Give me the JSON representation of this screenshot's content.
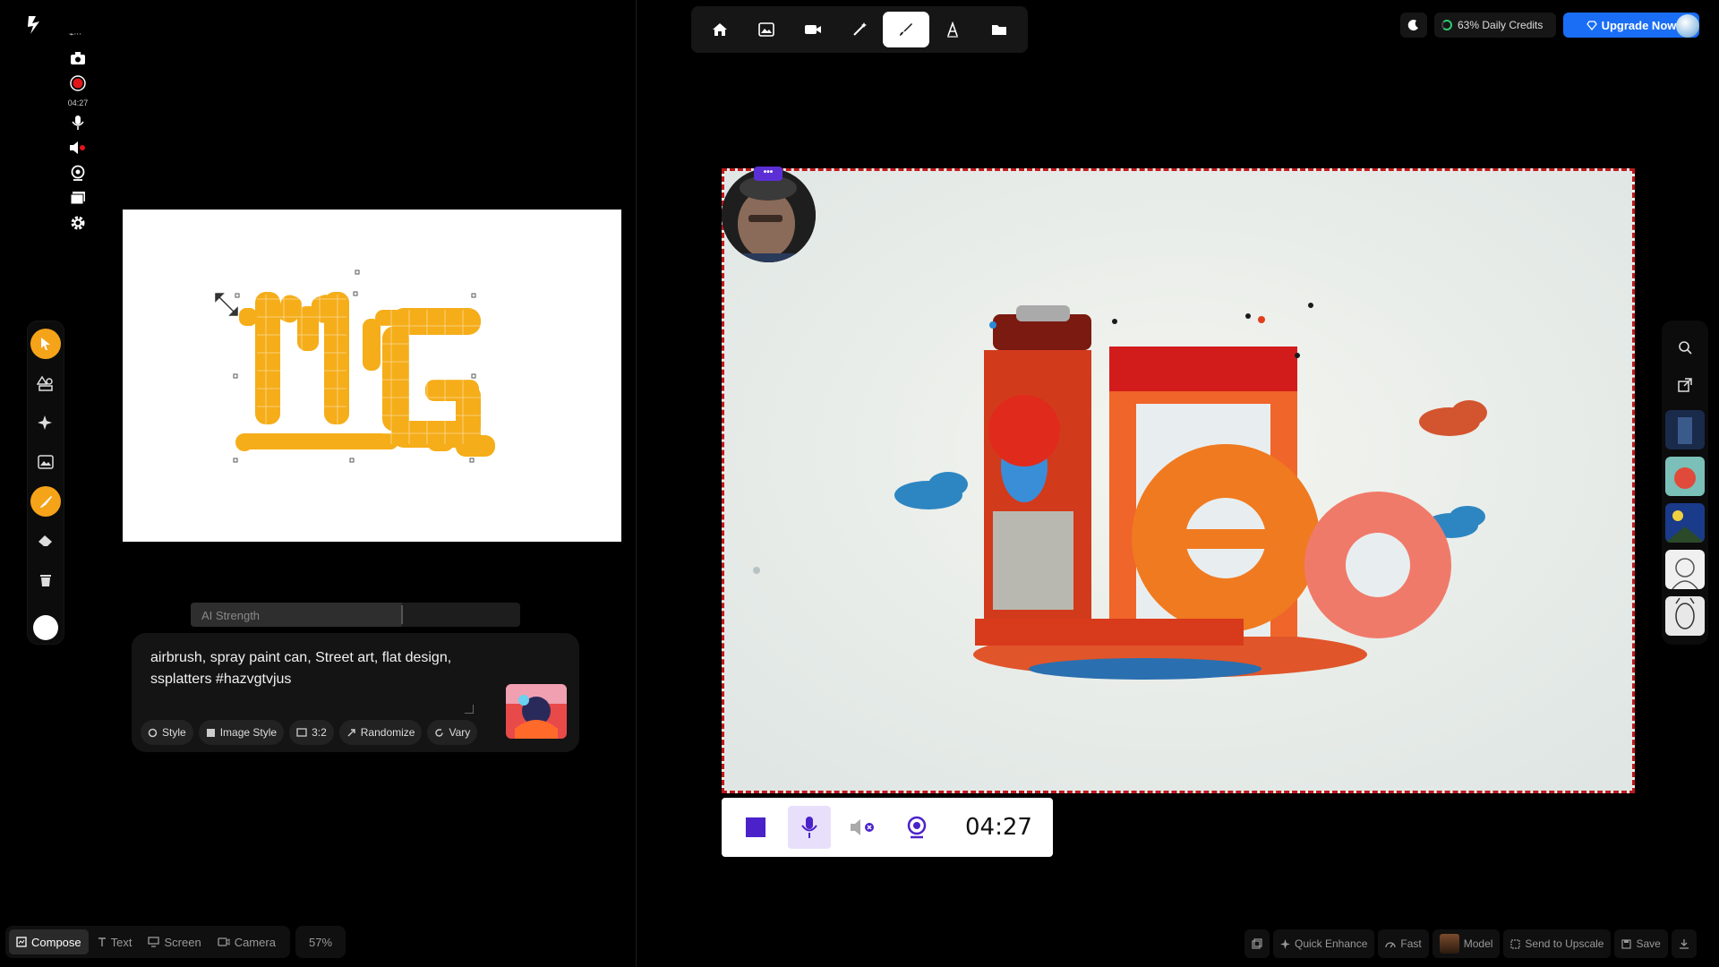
{
  "recording": {
    "timer_small": "04:27",
    "timer": "04:27"
  },
  "prompt": {
    "text": "airbrush, spray paint can, Street art, flat design, ssplatters #hazvgtvjus",
    "ai_strength_label": "AI Strength",
    "ai_strength_fraction": 0.64,
    "chips": {
      "style": "Style",
      "image_style": "Image Style",
      "ratio": "3:2",
      "randomize": "Randomize",
      "vary": "Vary"
    }
  },
  "top_right": {
    "credits": "63% Daily Credits",
    "upgrade": "Upgrade Now"
  },
  "bottom_left": {
    "compose": "Compose",
    "text": "Text",
    "screen": "Screen",
    "camera": "Camera",
    "zoom": "57%"
  },
  "bottom_right": {
    "quick_enhance": "Quick Enhance",
    "fast": "Fast",
    "model": "Model",
    "send_to_upscale": "Send to Upscale",
    "save": "Save"
  },
  "webcam_menu": "•••",
  "colors": {
    "accent_orange": "#f5a319",
    "upgrade_blue": "#1a6ef5",
    "canvas_border": "#c0181c",
    "rec_purple": "#5c2fd6"
  }
}
